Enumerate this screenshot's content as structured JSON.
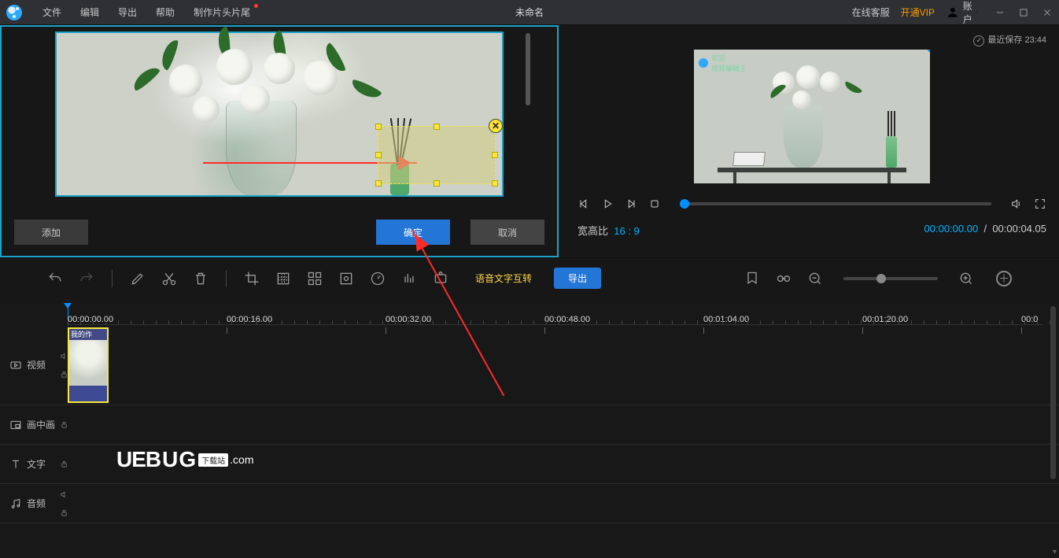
{
  "topbar": {
    "menus": [
      "文件",
      "编辑",
      "导出",
      "帮助",
      "制作片头片尾"
    ],
    "title": "未命名",
    "online_cs": "在线客服",
    "vip": "开通VIP",
    "account": "账户"
  },
  "mosaic_panel": {
    "add": "添加",
    "confirm": "确定",
    "cancel": "取消"
  },
  "preview": {
    "autosave": "最近保存 23:44",
    "ratio_label": "宽高比",
    "ratio_value": "16 : 9",
    "time_current": "00:00:00.00",
    "time_sep": "/",
    "time_total": "00:00:04.05"
  },
  "toolbar": {
    "tts": "语音文字互转",
    "export": "导出"
  },
  "timeline": {
    "ticks": [
      "00:00:00.00",
      "00:00:16.00",
      "00:00:32.00",
      "00:00:48.00",
      "00:01:04.00",
      "00:01:20.00",
      "00:0"
    ],
    "clip_label": "我的作",
    "tracks": {
      "video": "视频",
      "pip": "画中画",
      "text": "文字",
      "audio": "音频"
    }
  },
  "watermark": {
    "a": "UE",
    "b": "BUG",
    "c": "下载站",
    "d": ".com"
  }
}
